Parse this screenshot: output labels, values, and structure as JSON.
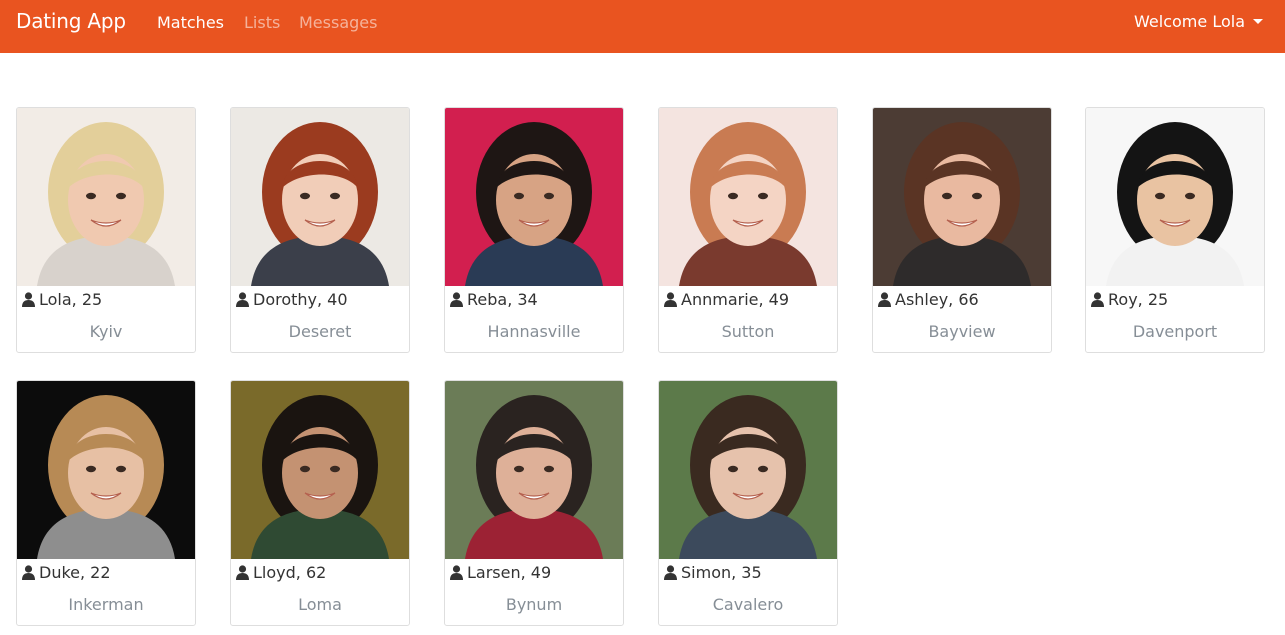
{
  "nav": {
    "brand": "Dating App",
    "links": [
      {
        "label": "Matches",
        "state": "active"
      },
      {
        "label": "Lists",
        "state": "muted"
      },
      {
        "label": "Messages",
        "state": "muted"
      }
    ],
    "user_menu": "Welcome Lola",
    "accent_color": "#e95420"
  },
  "matches": [
    {
      "name_age": "Lola, 25",
      "city": "Kyiv",
      "photo": {
        "bg": "#f2ece6",
        "skin": "#f0c9b0",
        "hair": "#e3cf9a",
        "shirt": "#d8d2cc"
      }
    },
    {
      "name_age": "Dorothy, 40",
      "city": "Deseret",
      "photo": {
        "bg": "#ece9e4",
        "skin": "#f1cdb8",
        "hair": "#9b3b1f",
        "shirt": "#3b3f4a"
      }
    },
    {
      "name_age": "Reba, 34",
      "city": "Hannasville",
      "photo": {
        "bg": "#d21f4f",
        "skin": "#d7a384",
        "hair": "#1e1614",
        "shirt": "#2a3b55"
      }
    },
    {
      "name_age": "Annmarie, 49",
      "city": "Sutton",
      "photo": {
        "bg": "#f4e4e0",
        "skin": "#f4d4c4",
        "hair": "#c97b52",
        "shirt": "#7a3a2e"
      }
    },
    {
      "name_age": "Ashley, 66",
      "city": "Bayview",
      "photo": {
        "bg": "#4c3c34",
        "skin": "#e9b9a0",
        "hair": "#5a3424",
        "shirt": "#2e2b2b"
      }
    },
    {
      "name_age": "Roy, 25",
      "city": "Davenport",
      "photo": {
        "bg": "#f7f7f7",
        "skin": "#e9c3a2",
        "hair": "#141414",
        "shirt": "#f2f2f2"
      }
    },
    {
      "name_age": "Duke, 22",
      "city": "Inkerman",
      "photo": {
        "bg": "#0c0c0c",
        "skin": "#e7c0a4",
        "hair": "#b78a55",
        "shirt": "#8e8e8e"
      }
    },
    {
      "name_age": "Lloyd, 62",
      "city": "Loma",
      "photo": {
        "bg": "#7a6a2a",
        "skin": "#c49272",
        "hair": "#1a1410",
        "shirt": "#2f4a33"
      }
    },
    {
      "name_age": "Larsen, 49",
      "city": "Bynum",
      "photo": {
        "bg": "#6b7c57",
        "skin": "#deb098",
        "hair": "#2a2320",
        "shirt": "#9c2234"
      }
    },
    {
      "name_age": "Simon, 35",
      "city": "Cavalero",
      "photo": {
        "bg": "#5c7a4a",
        "skin": "#e6c2ac",
        "hair": "#3a2a20",
        "shirt": "#3c4a5c"
      }
    }
  ]
}
